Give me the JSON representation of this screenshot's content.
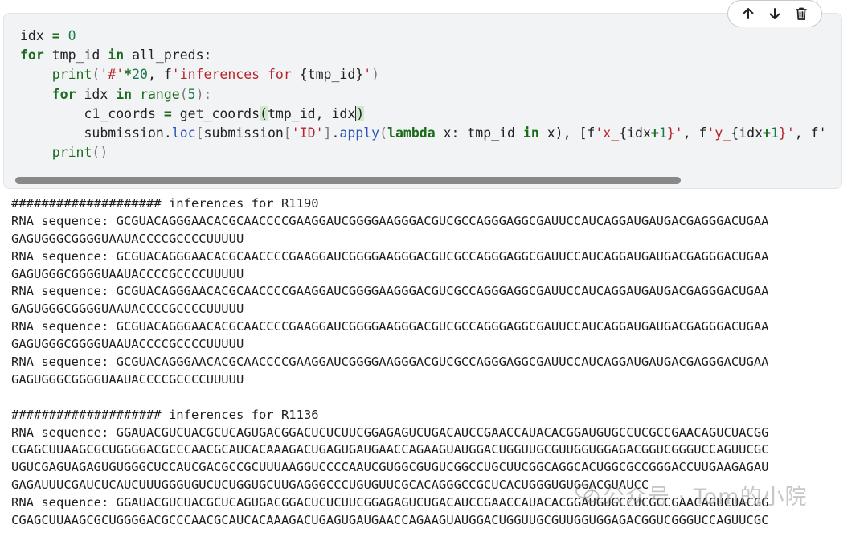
{
  "toolbar": {
    "move_up_icon": "arrow-up-icon",
    "move_down_icon": "arrow-down-icon",
    "delete_icon": "trash-icon"
  },
  "code": {
    "line1": [
      "idx",
      "=",
      "0"
    ],
    "line2": [
      "for",
      "tmp_id",
      "in",
      "all_preds:"
    ],
    "line3": [
      "print",
      "(",
      "'#'",
      "*",
      "20",
      ", f",
      "'inferences for ",
      "{tmp_id}",
      "'",
      ")"
    ],
    "line4": [
      "for",
      "idx",
      "in",
      "range",
      "(",
      "5",
      "):"
    ],
    "line5": [
      "c1_coords",
      "=",
      "get_coords",
      "(",
      "tmp_id, idx",
      ")"
    ],
    "line6": [
      "submission",
      ".",
      "loc",
      "[",
      "submission",
      "[",
      "'ID'",
      "]",
      ".",
      "apply",
      "(",
      "lambda",
      " x: tmp_id ",
      "in",
      " x), [f",
      "'x_",
      "{idx",
      "+",
      "1",
      "}'",
      ", f",
      "'y_",
      "{idx",
      "+",
      "1",
      "}'",
      ", f'"
    ],
    "line7": [
      "print",
      "()"
    ]
  },
  "output": {
    "lines": [
      "#################### inferences for R1190",
      "RNA sequence: GCGUACAGGGAACACGCAACCCCGAAGGAUCGGGGAAGGGACGUCGCCAGGGAGGCGAUUCCAUCAGGAUGAUGACGAGGGACUGAA",
      "GAGUGGGCGGGGUAAUACCCCGCCCCUUUUU",
      "RNA sequence: GCGUACAGGGAACACGCAACCCCGAAGGAUCGGGGAAGGGACGUCGCCAGGGAGGCGAUUCCAUCAGGAUGAUGACGAGGGACUGAA",
      "GAGUGGGCGGGGUAAUACCCCGCCCCUUUUU",
      "RNA sequence: GCGUACAGGGAACACGCAACCCCGAAGGAUCGGGGAAGGGACGUCGCCAGGGAGGCGAUUCCAUCAGGAUGAUGACGAGGGACUGAA",
      "GAGUGGGCGGGGUAAUACCCCGCCCCUUUUU",
      "RNA sequence: GCGUACAGGGAACACGCAACCCCGAAGGAUCGGGGAAGGGACGUCGCCAGGGAGGCGAUUCCAUCAGGAUGAUGACGAGGGACUGAA",
      "GAGUGGGCGGGGUAAUACCCCGCCCCUUUUU",
      "RNA sequence: GCGUACAGGGAACACGCAACCCCGAAGGAUCGGGGAAGGGACGUCGCCAGGGAGGCGAUUCCAUCAGGAUGAUGACGAGGGACUGAA",
      "GAGUGGGCGGGGUAAUACCCCGCCCCUUUUU",
      "",
      "#################### inferences for R1136",
      "RNA sequence: GGAUACGUCUACGCUCAGUGACGGACUCUCUUCGGAGAGUCUGACAUCCGAACCAUACACGGAUGUGCCUCGCCGAACAGUCUACGG",
      "CGAGCUUAAGCGCUGGGGACGCCCAACGCAUCACAAAGACUGAGUGAUGAACCAGAAGUAUGGACUGGUUGCGUUGGUGGAGACGGUCGGGUCCAGUUCGC",
      "UGUCGAGUAGAGUGUGGGCUCCAUCGACGCCGCUUUAAGGUCCCCAAUCGUGGCGUGUCGGCCUGCUUCGGCAGGCACUGGCGCCGGGACCUUGAAGAGAU",
      "GAGAUUUCGAUCUCAUCUUUGGGUGUCUCUGGUGCUUGAGGGCCCUGUGUUCGCACAGGGCCGCUCACUGGGUGUGGACGUAUCC",
      "RNA sequence: GGAUACGUCUACGCUCAGUGACGGACUCUCUUCGGAGAGUCUGACAUCCGAACCAUACACGGAUGUGCCUCGCCGAACAGUCUACGG",
      "CGAGCUUAAGCGCUGGGGACGCCCAACGCAUCACAAAGACUGAGUGAUGAACCAGAAGUAUGGACUGGUUGCGUUGGUGGAGACGGUCGGGUCCAGUUCGC"
    ]
  },
  "watermark": {
    "text": "公众号 · Tom的小院"
  }
}
